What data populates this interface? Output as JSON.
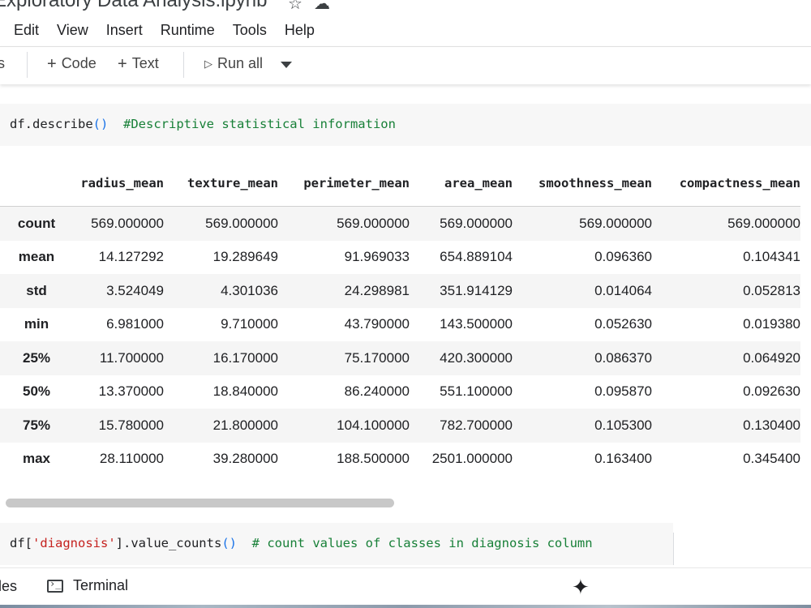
{
  "window": {
    "title": "Exploratory Data Analysis.ipynb"
  },
  "title_icons": {
    "star": "☆",
    "cloud": "☁"
  },
  "menu": [
    "Edit",
    "View",
    "Insert",
    "Runtime",
    "Tools",
    "Help"
  ],
  "toolbar": {
    "fragment": "s",
    "add_code": "Code",
    "add_text": "Text",
    "run_all": "Run all",
    "plus_glyph": "+",
    "play_glyph": "▷"
  },
  "cell1": {
    "code": "df.describe",
    "open_paren": "(",
    "close_paren": ")",
    "comment": "  #Descriptive statistical information"
  },
  "table": {
    "columns": [
      "radius_mean",
      "texture_mean",
      "perimeter_mean",
      "area_mean",
      "smoothness_mean",
      "compactness_mean"
    ],
    "rows": [
      {
        "label": "count",
        "values": [
          "569.000000",
          "569.000000",
          "569.000000",
          "569.000000",
          "569.000000",
          "569.000000"
        ]
      },
      {
        "label": "mean",
        "values": [
          "14.127292",
          "19.289649",
          "91.969033",
          "654.889104",
          "0.096360",
          "0.104341"
        ]
      },
      {
        "label": "std",
        "values": [
          "3.524049",
          "4.301036",
          "24.298981",
          "351.914129",
          "0.014064",
          "0.052813"
        ]
      },
      {
        "label": "min",
        "values": [
          "6.981000",
          "9.710000",
          "43.790000",
          "143.500000",
          "0.052630",
          "0.019380"
        ]
      },
      {
        "label": "25%",
        "values": [
          "11.700000",
          "16.170000",
          "75.170000",
          "420.300000",
          "0.086370",
          "0.064920"
        ]
      },
      {
        "label": "50%",
        "values": [
          "13.370000",
          "18.840000",
          "86.240000",
          "551.100000",
          "0.095870",
          "0.092630"
        ]
      },
      {
        "label": "75%",
        "values": [
          "15.780000",
          "21.800000",
          "104.100000",
          "782.700000",
          "0.105300",
          "0.130400"
        ]
      },
      {
        "label": "max",
        "values": [
          "28.110000",
          "39.280000",
          "188.500000",
          "2501.000000",
          "0.163400",
          "0.345400"
        ]
      }
    ]
  },
  "cell2": {
    "prefix": "df[",
    "string": "'diagnosis'",
    "mid": "].value_counts",
    "open_paren": "(",
    "close_paren": ")",
    "comment": "  # count values of classes in diagnosis column"
  },
  "bottombar": {
    "fragment": "les",
    "terminal": "Terminal",
    "sparkle": "✦"
  },
  "colors": {
    "comment": "#188038",
    "string": "#c5221f",
    "paren": "#1a73e8"
  }
}
